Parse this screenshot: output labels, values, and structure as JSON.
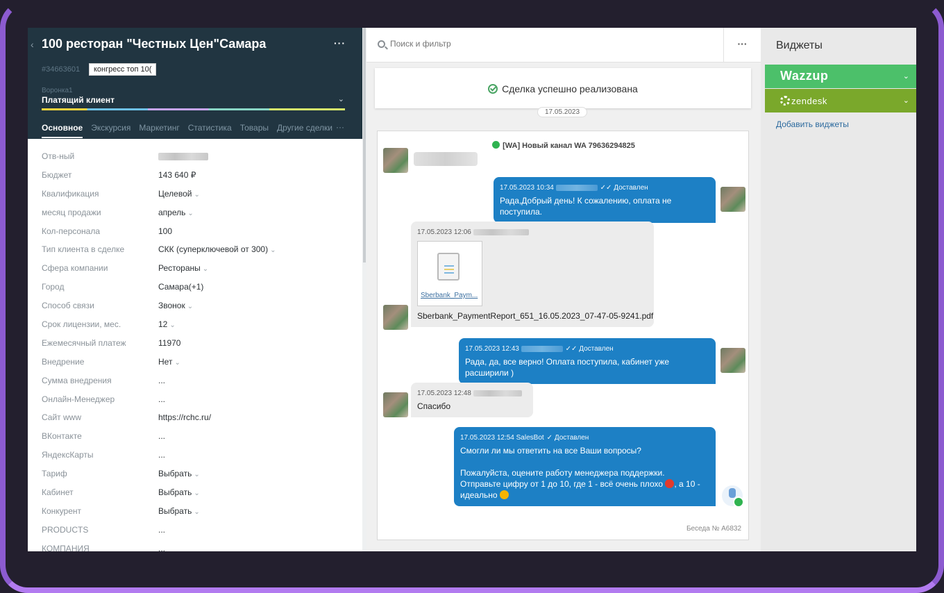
{
  "deal": {
    "title": "100 ресторан \"Честных Цен\"Самара",
    "id": "#34663601",
    "tag": "конгресс топ 10(",
    "funnel": "Воронка1",
    "stage": "Платящий клиент",
    "more": "···",
    "back": "‹"
  },
  "tabs": [
    "Основное",
    "Экскурсия",
    "Маркетинг",
    "Статистика",
    "Товары",
    "Другие сделки"
  ],
  "tabs_more": "···",
  "fields": [
    {
      "label": "Отв-ный",
      "value": "",
      "blur": true
    },
    {
      "label": "Бюджет",
      "value": "143 640 ₽"
    },
    {
      "label": "Квалификация",
      "value": "Целевой",
      "dropdown": true
    },
    {
      "label": "месяц продажи",
      "value": "апрель",
      "dropdown": true
    },
    {
      "label": "Кол-персонала",
      "value": "100"
    },
    {
      "label": "Тип клиента в сделке",
      "value": "СКК (суперключевой от 300)",
      "dropdown": true
    },
    {
      "label": "Сфера компании",
      "value": "Рестораны",
      "dropdown": true
    },
    {
      "label": "Город",
      "value": "Самара(+1)"
    },
    {
      "label": "Способ связи",
      "value": "Звонок",
      "dropdown": true
    },
    {
      "label": "Срок лицензии, мес.",
      "value": "12",
      "dropdown": true
    },
    {
      "label": "Ежемесячный платеж",
      "value": "11970"
    },
    {
      "label": "Внедрение",
      "value": "Нет",
      "dropdown": true
    },
    {
      "label": "Сумма внедрения",
      "value": "..."
    },
    {
      "label": "Онлайн-Менеджер",
      "value": "..."
    },
    {
      "label": "Сайт www",
      "value": "https://rchc.ru/"
    },
    {
      "label": "ВКонтакте",
      "value": "..."
    },
    {
      "label": "ЯндексКарты",
      "value": "..."
    },
    {
      "label": "Тариф",
      "value": "Выбрать",
      "dropdown": true
    },
    {
      "label": "Кабинет",
      "value": "Выбрать",
      "dropdown": true
    },
    {
      "label": "Конкурент",
      "value": "Выбрать",
      "dropdown": true
    },
    {
      "label": "PRODUCTS",
      "value": "..."
    },
    {
      "label": "КОМПАНИЯ",
      "value": "..."
    }
  ],
  "search": {
    "placeholder": "Поиск и фильтр",
    "more": "···"
  },
  "feed": {
    "success": "Сделка успешно реализована",
    "date": "17.05.2023",
    "channel": "[WA] Новый канал WA 79636294825",
    "messages": {
      "m1": {
        "time": "17.05.2023 10:34",
        "status": "Доставлен",
        "text": "Рада,Добрый день! К сожалению, оплата не поступила."
      },
      "m2": {
        "time": "17.05.2023 12:06",
        "file_short": "Sberbank_Paym...",
        "file_full": "Sberbank_PaymentReport_651_16.05.2023_07-47-05-9241.pdf"
      },
      "m3": {
        "time": "17.05.2023 12:43",
        "status": "Доставлен",
        "text": "Рада, да, все верно! Оплата поступила, кабинет уже расширили )"
      },
      "m4": {
        "time": "17.05.2023 12:48",
        "text": "Спасибо"
      },
      "m5": {
        "time": "17.05.2023 12:54 SalesBot",
        "status": "Доставлен",
        "line1": "Смогли ли мы ответить на все Ваши вопросы?",
        "line2": "Пожалуйста, оцените работу менеджера поддержки.",
        "line3a": "Отправьте цифру от 1 до 10, где 1 - всё очень плохо",
        "line3b": ", а 10 -",
        "line4": "идеально"
      }
    },
    "conversation": "Беседа № А6832"
  },
  "widgets": {
    "title": "Виджеты",
    "wazzup": "Wazzup",
    "zendesk": "zendesk",
    "add": "Добавить виджеты"
  },
  "colors": {
    "header_bg": "#213541",
    "out_bubble": "#1d80c5",
    "wazzup": "#4cc06a",
    "zendesk": "#7aa82b"
  }
}
